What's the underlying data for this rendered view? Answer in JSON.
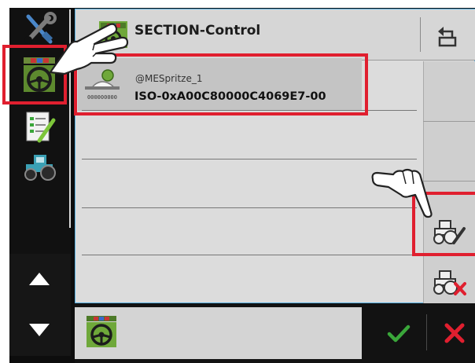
{
  "header": {
    "title": "SECTION-Control",
    "icon": "section-control-app-icon",
    "back_icon": "return-arrow-icon"
  },
  "sidebar": {
    "items": [
      {
        "icon": "wrench-screwdriver-icon"
      },
      {
        "icon": "section-control-steering-icon"
      },
      {
        "icon": "checklist-icon"
      },
      {
        "icon": "tractor-icon"
      }
    ],
    "arrows": [
      {
        "icon": "arrow-up-icon"
      },
      {
        "icon": "arrow-down-icon"
      }
    ]
  },
  "list": {
    "rows": [
      {
        "name": "@MESpritze_1",
        "id": "ISO-0xA00C80000C4069E7-00",
        "icon": "sprayer-implement-icon"
      }
    ]
  },
  "side_buttons": [
    {
      "icon": "tractor-edit-icon"
    },
    {
      "icon": "tractor-delete-icon"
    }
  ],
  "bottom_bar": {
    "app_icon": "section-control-steering-icon",
    "confirm_icon": "checkmark-icon",
    "cancel_icon": "close-x-icon"
  },
  "colors": {
    "highlight": "#e01f2f",
    "confirm": "#3aa63a",
    "cancel": "#e01f2f",
    "accent_border": "#57b0e0"
  }
}
